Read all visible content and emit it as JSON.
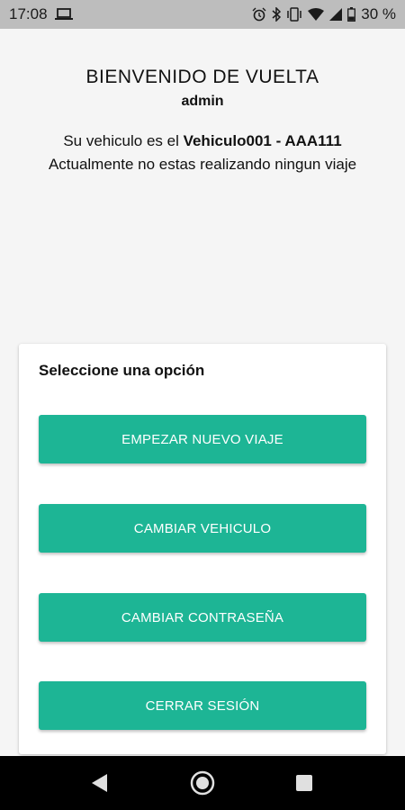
{
  "status_bar": {
    "time": "17:08",
    "battery": "30 %",
    "icons": [
      "laptop-icon",
      "alarm-icon",
      "bluetooth-icon",
      "vibrate-icon",
      "wifi-icon",
      "signal-icon",
      "battery-icon"
    ]
  },
  "welcome": {
    "title": "BIENVENIDO DE VUELTA",
    "username": "admin",
    "vehicle_prefix": "Su vehiculo es el ",
    "vehicle_name": "Vehiculo001 - AAA111",
    "trip_status": "Actualmente no estas realizando ningun viaje"
  },
  "options": {
    "title": "Seleccione una opción",
    "start_trip": "EMPEZAR NUEVO VIAJE",
    "change_vehicle": "CAMBIAR VEHICULO",
    "change_password": "CAMBIAR CONTRASEÑA",
    "logout": "CERRAR SESIÓN"
  },
  "colors": {
    "accent": "#1db595",
    "status_bar": "#bdbdbd",
    "background": "#f5f5f5",
    "nav_bar": "#000000"
  },
  "nav": [
    "back-icon",
    "home-icon",
    "recents-icon"
  ]
}
